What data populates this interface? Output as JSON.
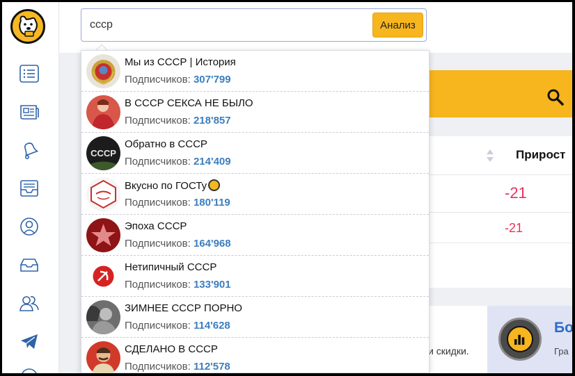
{
  "search": {
    "value": "ссср",
    "button_label": "Анализ"
  },
  "sidebar": {
    "icons": [
      "list-icon",
      "news-icon",
      "bell-icon",
      "inbox-icon",
      "support-icon",
      "tray-icon",
      "users-icon",
      "telegram-icon"
    ]
  },
  "background": {
    "column_header": "Прирост",
    "rows": [
      "-21",
      "-21"
    ],
    "promo_text": "и скидки.",
    "promo_title": "Бо",
    "promo_sub": "Гра"
  },
  "results_label": "Подписчиков:",
  "results": [
    {
      "name": "Мы из СССР | История",
      "count": "307'799"
    },
    {
      "name": "В СССР СЕКСА НЕ БЫЛО",
      "count": "218'857"
    },
    {
      "name": "Обратно в СССР",
      "count": "214'409"
    },
    {
      "name": "Вкусно по ГОСТу",
      "count": "180'119"
    },
    {
      "name": "Эпоха СССР",
      "count": "164'968"
    },
    {
      "name": "Нетипичный СССР",
      "count": "133'901"
    },
    {
      "name": "ЗИМНЕЕ СССР ПОРНО",
      "count": "114'628"
    },
    {
      "name": "СДЕЛАНО В СССР",
      "count": "112'578"
    }
  ],
  "colors": {
    "accent": "#f7b51e",
    "count": "#3c7ebf",
    "negative": "#e8315b",
    "link": "#2a6dc9"
  }
}
